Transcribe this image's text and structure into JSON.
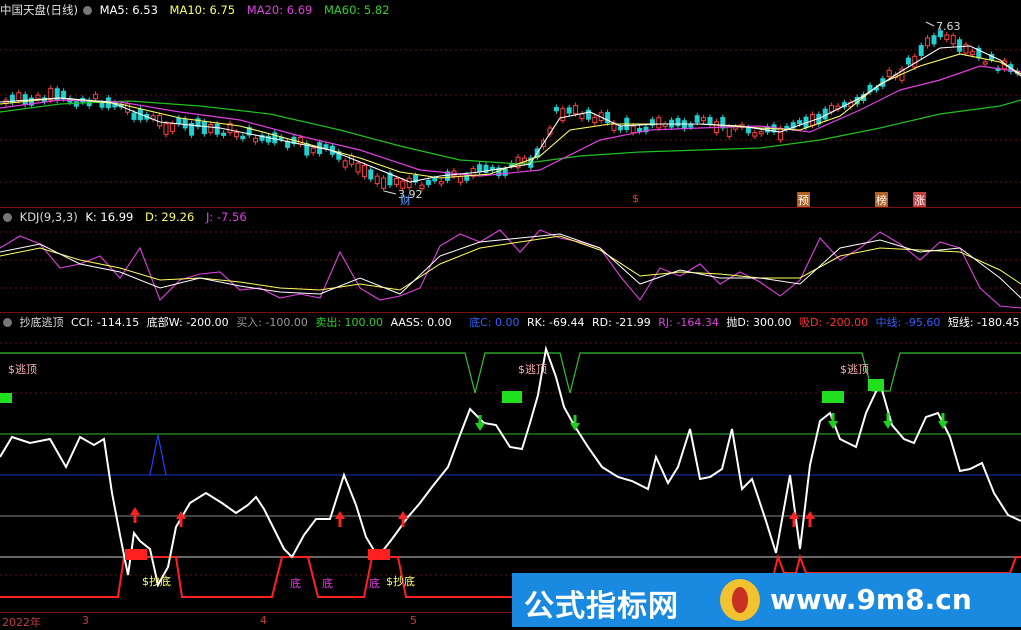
{
  "main_panel": {
    "title": "中国天盘(日线)",
    "ma5": "MA5: 6.53",
    "ma10": "MA10: 6.75",
    "ma20": "MA20: 6.69",
    "ma60": "MA60: 5.82",
    "high_label": "7.63",
    "low_label": "3.92",
    "tags": [
      "财",
      "$",
      "预",
      "榜",
      "涨"
    ]
  },
  "kdj_panel": {
    "name": "KDJ(9,3,3)",
    "k": "K: 16.99",
    "d": "D: 29.26",
    "j": "J: -7.56"
  },
  "indicator_panel": {
    "name": "抄底逃顶",
    "cci": "CCI: -114.15",
    "dibu": "底部W: -200.00",
    "buy": "买入: -100.00",
    "sell": "卖出: 100.00",
    "aass": "AASS: 0.00",
    "dic": "底C: 0.00",
    "rk": "RK: -69.44",
    "rd": "RD: -21.99",
    "rj": "RJ: -164.34",
    "pao": "抛D: 300.00",
    "xi": "吸D: -200.00",
    "zhong": "中线: -95.60",
    "duan": "短线: -180.45",
    "tao": "逃顶",
    "labels": {
      "escape1": "$逃顶",
      "escape2": "$逃顶",
      "escape3": "$逃顶",
      "bottom1": "$抄底",
      "bottom2": "$抄底",
      "di1": "底",
      "di2": "底",
      "di3": "底"
    }
  },
  "dates": [
    "2022年",
    "3",
    "4",
    "5"
  ],
  "watermark": {
    "left": "公式指标网",
    "right": "www.9m8.cn"
  },
  "colors": {
    "up": "#ff4040",
    "down": "#20d0d0",
    "ma5": "#ffffff",
    "ma10": "#ffff60",
    "ma20": "#e040e0",
    "ma60": "#20c020",
    "grid": "#8a1010"
  }
}
